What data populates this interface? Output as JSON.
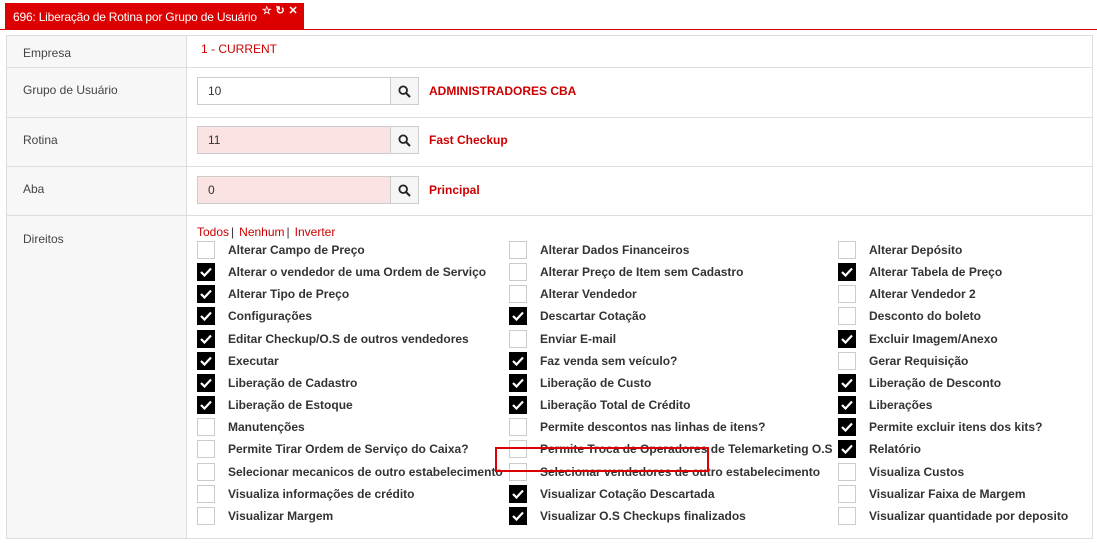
{
  "tab": {
    "title": "696: Liberação de Rotina por Grupo de Usuário",
    "icons": [
      "star-icon",
      "refresh-icon",
      "close-icon"
    ]
  },
  "form": {
    "empresa": {
      "label": "Empresa",
      "value": "1 - CURRENT"
    },
    "grupo": {
      "label": "Grupo de Usuário",
      "value": "10",
      "name": "ADMINISTRADORES CBA"
    },
    "rotina": {
      "label": "Rotina",
      "value": "11",
      "name": "Fast Checkup"
    },
    "aba": {
      "label": "Aba",
      "value": "0",
      "name": "Principal"
    },
    "direitos": {
      "label": "Direitos"
    }
  },
  "links": {
    "todos": "Todos",
    "nenhum": "Nenhum",
    "inverter": "Inverter"
  },
  "rights": {
    "col1": [
      {
        "label": "Alterar Campo de Preço",
        "checked": false
      },
      {
        "label": "Alterar o vendedor de uma Ordem de Serviço",
        "checked": true
      },
      {
        "label": "Alterar Tipo de Preço",
        "checked": true
      },
      {
        "label": "Configurações",
        "checked": true
      },
      {
        "label": "Editar Checkup/O.S de outros vendedores",
        "checked": true
      },
      {
        "label": "Executar",
        "checked": true
      },
      {
        "label": "Liberação de Cadastro",
        "checked": true
      },
      {
        "label": "Liberação de Estoque",
        "checked": true
      },
      {
        "label": "Manutenções",
        "checked": false
      },
      {
        "label": "Permite Tirar Ordem de Serviço do Caixa?",
        "checked": false
      },
      {
        "label": "Selecionar mecanicos de outro estabelecimento",
        "checked": false
      },
      {
        "label": "Visualiza informações de crédito",
        "checked": false
      },
      {
        "label": "Visualizar Margem",
        "checked": false
      }
    ],
    "col2": [
      {
        "label": "Alterar Dados Financeiros",
        "checked": false
      },
      {
        "label": "Alterar Preço de Item sem Cadastro",
        "checked": false
      },
      {
        "label": "Alterar Vendedor",
        "checked": false
      },
      {
        "label": "Descartar Cotação",
        "checked": true
      },
      {
        "label": "Enviar E-mail",
        "checked": false
      },
      {
        "label": "Faz venda sem veículo?",
        "checked": true
      },
      {
        "label": "Liberação de Custo",
        "checked": true
      },
      {
        "label": "Liberação Total de Crédito",
        "checked": true
      },
      {
        "label": "Permite descontos nas linhas de itens?",
        "checked": false
      },
      {
        "label": "Permite Troca de Operadores de Telemarketing O.S",
        "checked": false
      },
      {
        "label": "Selecionar vendedores de outro estabelecimento",
        "checked": false
      },
      {
        "label": "Visualizar Cotação Descartada",
        "checked": true
      },
      {
        "label": "Visualizar O.S Checkups finalizados",
        "checked": true
      }
    ],
    "col3": [
      {
        "label": "Alterar Depósito",
        "checked": false
      },
      {
        "label": "Alterar Tabela de Preço",
        "checked": true
      },
      {
        "label": "Alterar Vendedor 2",
        "checked": false
      },
      {
        "label": "Desconto do boleto",
        "checked": false
      },
      {
        "label": "Excluir Imagem/Anexo",
        "checked": true
      },
      {
        "label": "Gerar Requisição",
        "checked": false
      },
      {
        "label": "Liberação de Desconto",
        "checked": true
      },
      {
        "label": "Liberações",
        "checked": true
      },
      {
        "label": "Permite excluir itens dos kits?",
        "checked": true
      },
      {
        "label": "Relatório",
        "checked": true
      },
      {
        "label": "Visualiza Custos",
        "checked": false
      },
      {
        "label": "Visualizar Faixa de Margem",
        "checked": false
      },
      {
        "label": "Visualizar quantidade por deposito",
        "checked": false
      }
    ]
  },
  "colors": {
    "accent": "#dd0000",
    "required_bg": "#fbe3e3",
    "border": "#dddddd"
  }
}
